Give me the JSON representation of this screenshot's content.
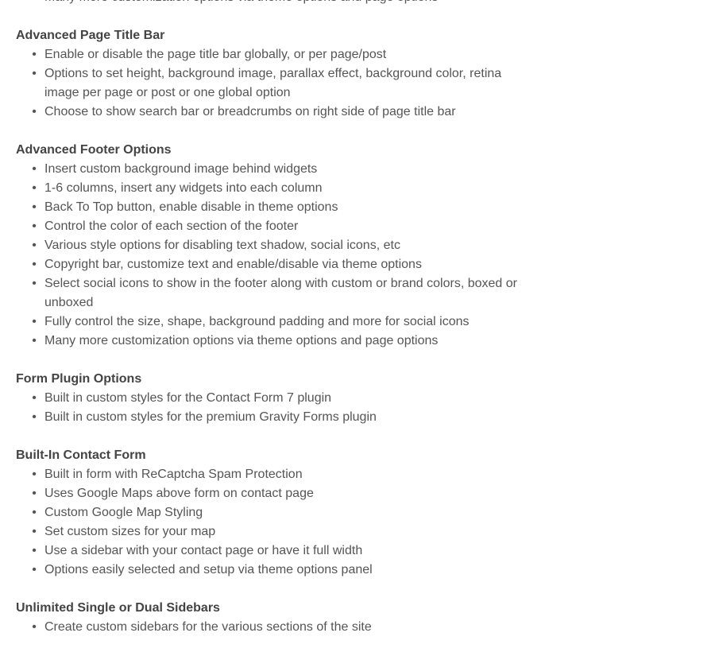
{
  "sections": [
    {
      "heading": "",
      "items": [
        "Many more customization options via theme options and page options"
      ]
    },
    {
      "heading": "Advanced Page Title Bar",
      "items": [
        "Enable or disable the page title bar globally, or per page/post",
        "Options to set height, background image, parallax effect, background color, retina image per page or post or one global option",
        "Choose to show search bar or breadcrumbs on right side of page title bar"
      ]
    },
    {
      "heading": "Advanced Footer Options",
      "items": [
        "Insert custom background image behind widgets",
        "1-6 columns, insert any widgets into each column",
        "Back To Top button, enable disable in theme options",
        "Control the color of each section of the footer",
        "Various style options for disabling text shadow, social icons, etc",
        "Copyright bar, customize text and enable/disable via theme options",
        "Select social icons to show in the footer along with custom or brand colors, boxed or unboxed",
        "Fully control the size, shape, background padding and more for social icons",
        "Many more customization options via theme options and page options"
      ]
    },
    {
      "heading": "Form Plugin Options",
      "items": [
        "Built in custom styles for the Contact Form 7 plugin",
        "Built in custom styles for the premium Gravity Forms plugin"
      ]
    },
    {
      "heading": "Built-In Contact Form",
      "items": [
        "Built in form with ReCaptcha Spam Protection",
        "Uses Google Maps above form on contact page",
        "Custom Google Map Styling",
        "Set custom sizes for your map",
        "Use a sidebar with your contact page or have it full width",
        "Options easily selected and setup via theme options panel"
      ]
    },
    {
      "heading": "Unlimited Single or Dual Sidebars",
      "items": [
        "Create custom sidebars for the various sections of the site"
      ]
    }
  ],
  "bullet_glyph": "•"
}
